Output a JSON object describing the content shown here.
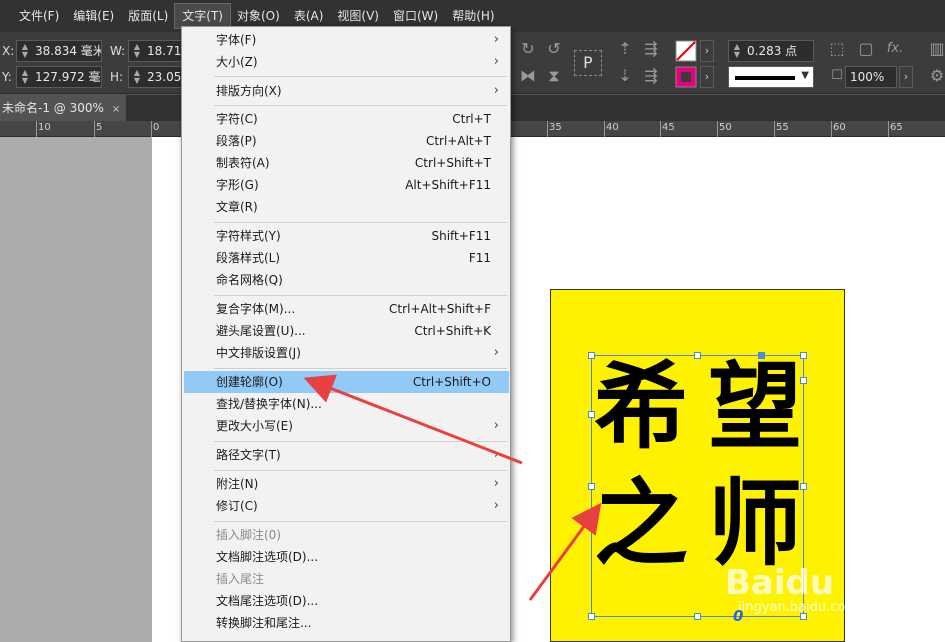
{
  "menubar": {
    "items": [
      "文件(F)",
      "编辑(E)",
      "版面(L)",
      "文字(T)",
      "对象(O)",
      "表(A)",
      "视图(V)",
      "窗口(W)",
      "帮助(H)"
    ]
  },
  "control": {
    "x_label": "X:",
    "x_value": "38.834 毫米",
    "y_label": "Y:",
    "y_value": "127.972 毫",
    "w_label": "W:",
    "w_value": "18.71",
    "h_label": "H:",
    "h_value": "23.05",
    "stroke_weight": "0.283 点",
    "opacity": "100%",
    "frame_glyph": "P",
    "fx_label": "fx."
  },
  "document_tab": {
    "title": "未命名-1 @ 300%",
    "close": "×"
  },
  "ruler": {
    "labels": [
      "10",
      "5",
      "0",
      "35",
      "40",
      "45",
      "50",
      "55",
      "60",
      "65"
    ]
  },
  "canvas": {
    "chars": [
      "希",
      "望",
      "之",
      "师"
    ],
    "overflow_marker": "0"
  },
  "watermark": {
    "main": "Baidu 经验",
    "sub": "jingyan.baidu.com"
  },
  "dropdown": {
    "items": [
      {
        "label": "字体(F)",
        "shortcut": "",
        "submenu": "›"
      },
      {
        "label": "大小(Z)",
        "shortcut": "",
        "submenu": "›"
      },
      {
        "label": "排版方向(X)",
        "shortcut": "",
        "submenu": "›"
      },
      {
        "label": "字符(C)",
        "shortcut": "Ctrl+T",
        "submenu": ""
      },
      {
        "label": "段落(P)",
        "shortcut": "Ctrl+Alt+T",
        "submenu": ""
      },
      {
        "label": "制表符(A)",
        "shortcut": "Ctrl+Shift+T",
        "submenu": ""
      },
      {
        "label": "字形(G)",
        "shortcut": "Alt+Shift+F11",
        "submenu": ""
      },
      {
        "label": "文章(R)",
        "shortcut": "",
        "submenu": ""
      },
      {
        "label": "字符样式(Y)",
        "shortcut": "Shift+F11",
        "submenu": ""
      },
      {
        "label": "段落样式(L)",
        "shortcut": "F11",
        "submenu": ""
      },
      {
        "label": "命名网格(Q)",
        "shortcut": "",
        "submenu": ""
      },
      {
        "label": "复合字体(M)...",
        "shortcut": "Ctrl+Alt+Shift+F",
        "submenu": ""
      },
      {
        "label": "避头尾设置(U)...",
        "shortcut": "Ctrl+Shift+K",
        "submenu": ""
      },
      {
        "label": "中文排版设置(J)",
        "shortcut": "",
        "submenu": "›"
      },
      {
        "label": "创建轮廓(O)",
        "shortcut": "Ctrl+Shift+O",
        "submenu": ""
      },
      {
        "label": "查找/替换字体(N)...",
        "shortcut": "",
        "submenu": ""
      },
      {
        "label": "更改大小写(E)",
        "shortcut": "",
        "submenu": "›"
      },
      {
        "label": "路径文字(T)",
        "shortcut": "",
        "submenu": "›"
      },
      {
        "label": "附注(N)",
        "shortcut": "",
        "submenu": "›"
      },
      {
        "label": "修订(C)",
        "shortcut": "",
        "submenu": "›"
      },
      {
        "label": "插入脚注(0)",
        "shortcut": "",
        "submenu": ""
      },
      {
        "label": "文档脚注选项(D)...",
        "shortcut": "",
        "submenu": ""
      },
      {
        "label": "插入尾注",
        "shortcut": "",
        "submenu": ""
      },
      {
        "label": "文档尾注选项(D)...",
        "shortcut": "",
        "submenu": ""
      },
      {
        "label": "转换脚注和尾注...",
        "shortcut": "",
        "submenu": ""
      }
    ]
  },
  "colors": {
    "highlight": "#91c9f7",
    "yellow": "#fff200",
    "arrow": "#e84040",
    "swatch_magenta": "#e6007e"
  }
}
